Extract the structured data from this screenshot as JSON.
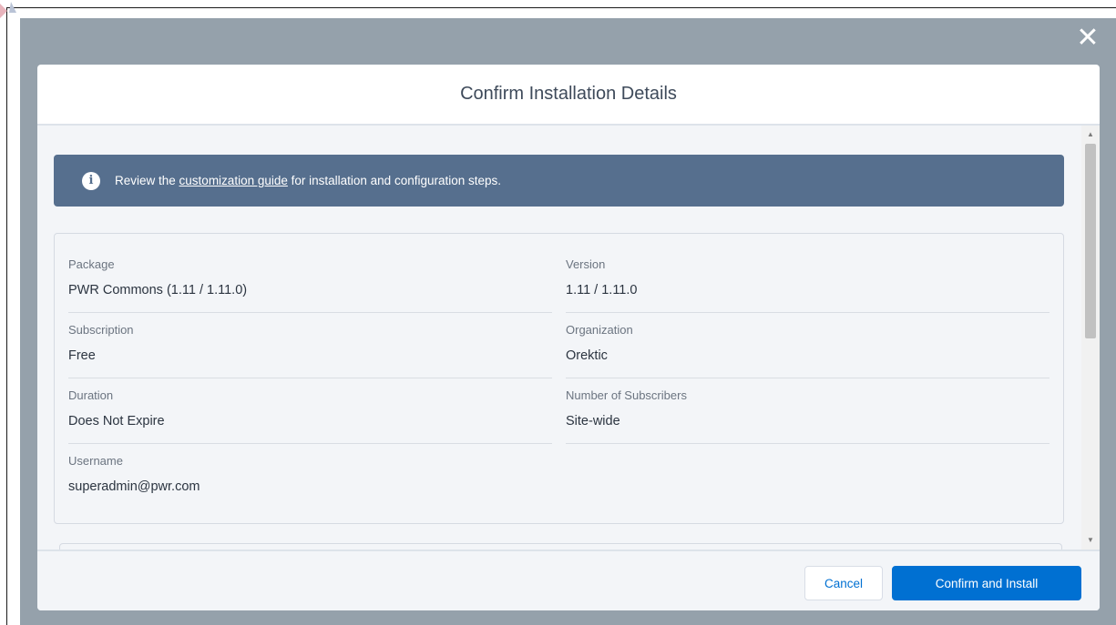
{
  "dialog": {
    "title": "Confirm Installation Details",
    "close_symbol": "✕"
  },
  "banner": {
    "icon": "info-icon",
    "icon_glyph": "i",
    "text_before": "Review the ",
    "link_text": "customization guide",
    "text_after": " for installation and configuration steps."
  },
  "details": {
    "package": {
      "label": "Package",
      "value": "PWR Commons (1.11 / 1.11.0)"
    },
    "version": {
      "label": "Version",
      "value": "1.11 / 1.11.0"
    },
    "subscription": {
      "label": "Subscription",
      "value": "Free"
    },
    "organization": {
      "label": "Organization",
      "value": "Orektic"
    },
    "duration": {
      "label": "Duration",
      "value": "Does Not Expire"
    },
    "subscribers": {
      "label": "Number of Subscribers",
      "value": "Site-wide"
    },
    "username": {
      "label": "Username",
      "value": "superadmin@pwr.com"
    }
  },
  "footer": {
    "cancel_label": "Cancel",
    "confirm_label": "Confirm and Install"
  },
  "scrollbar": {
    "up_glyph": "▲",
    "down_glyph": "▼"
  },
  "colors": {
    "backdrop": "#95a1ab",
    "banner": "#566f8e",
    "brand_button": "#0070d2",
    "body_bg": "#f3f5f8"
  }
}
